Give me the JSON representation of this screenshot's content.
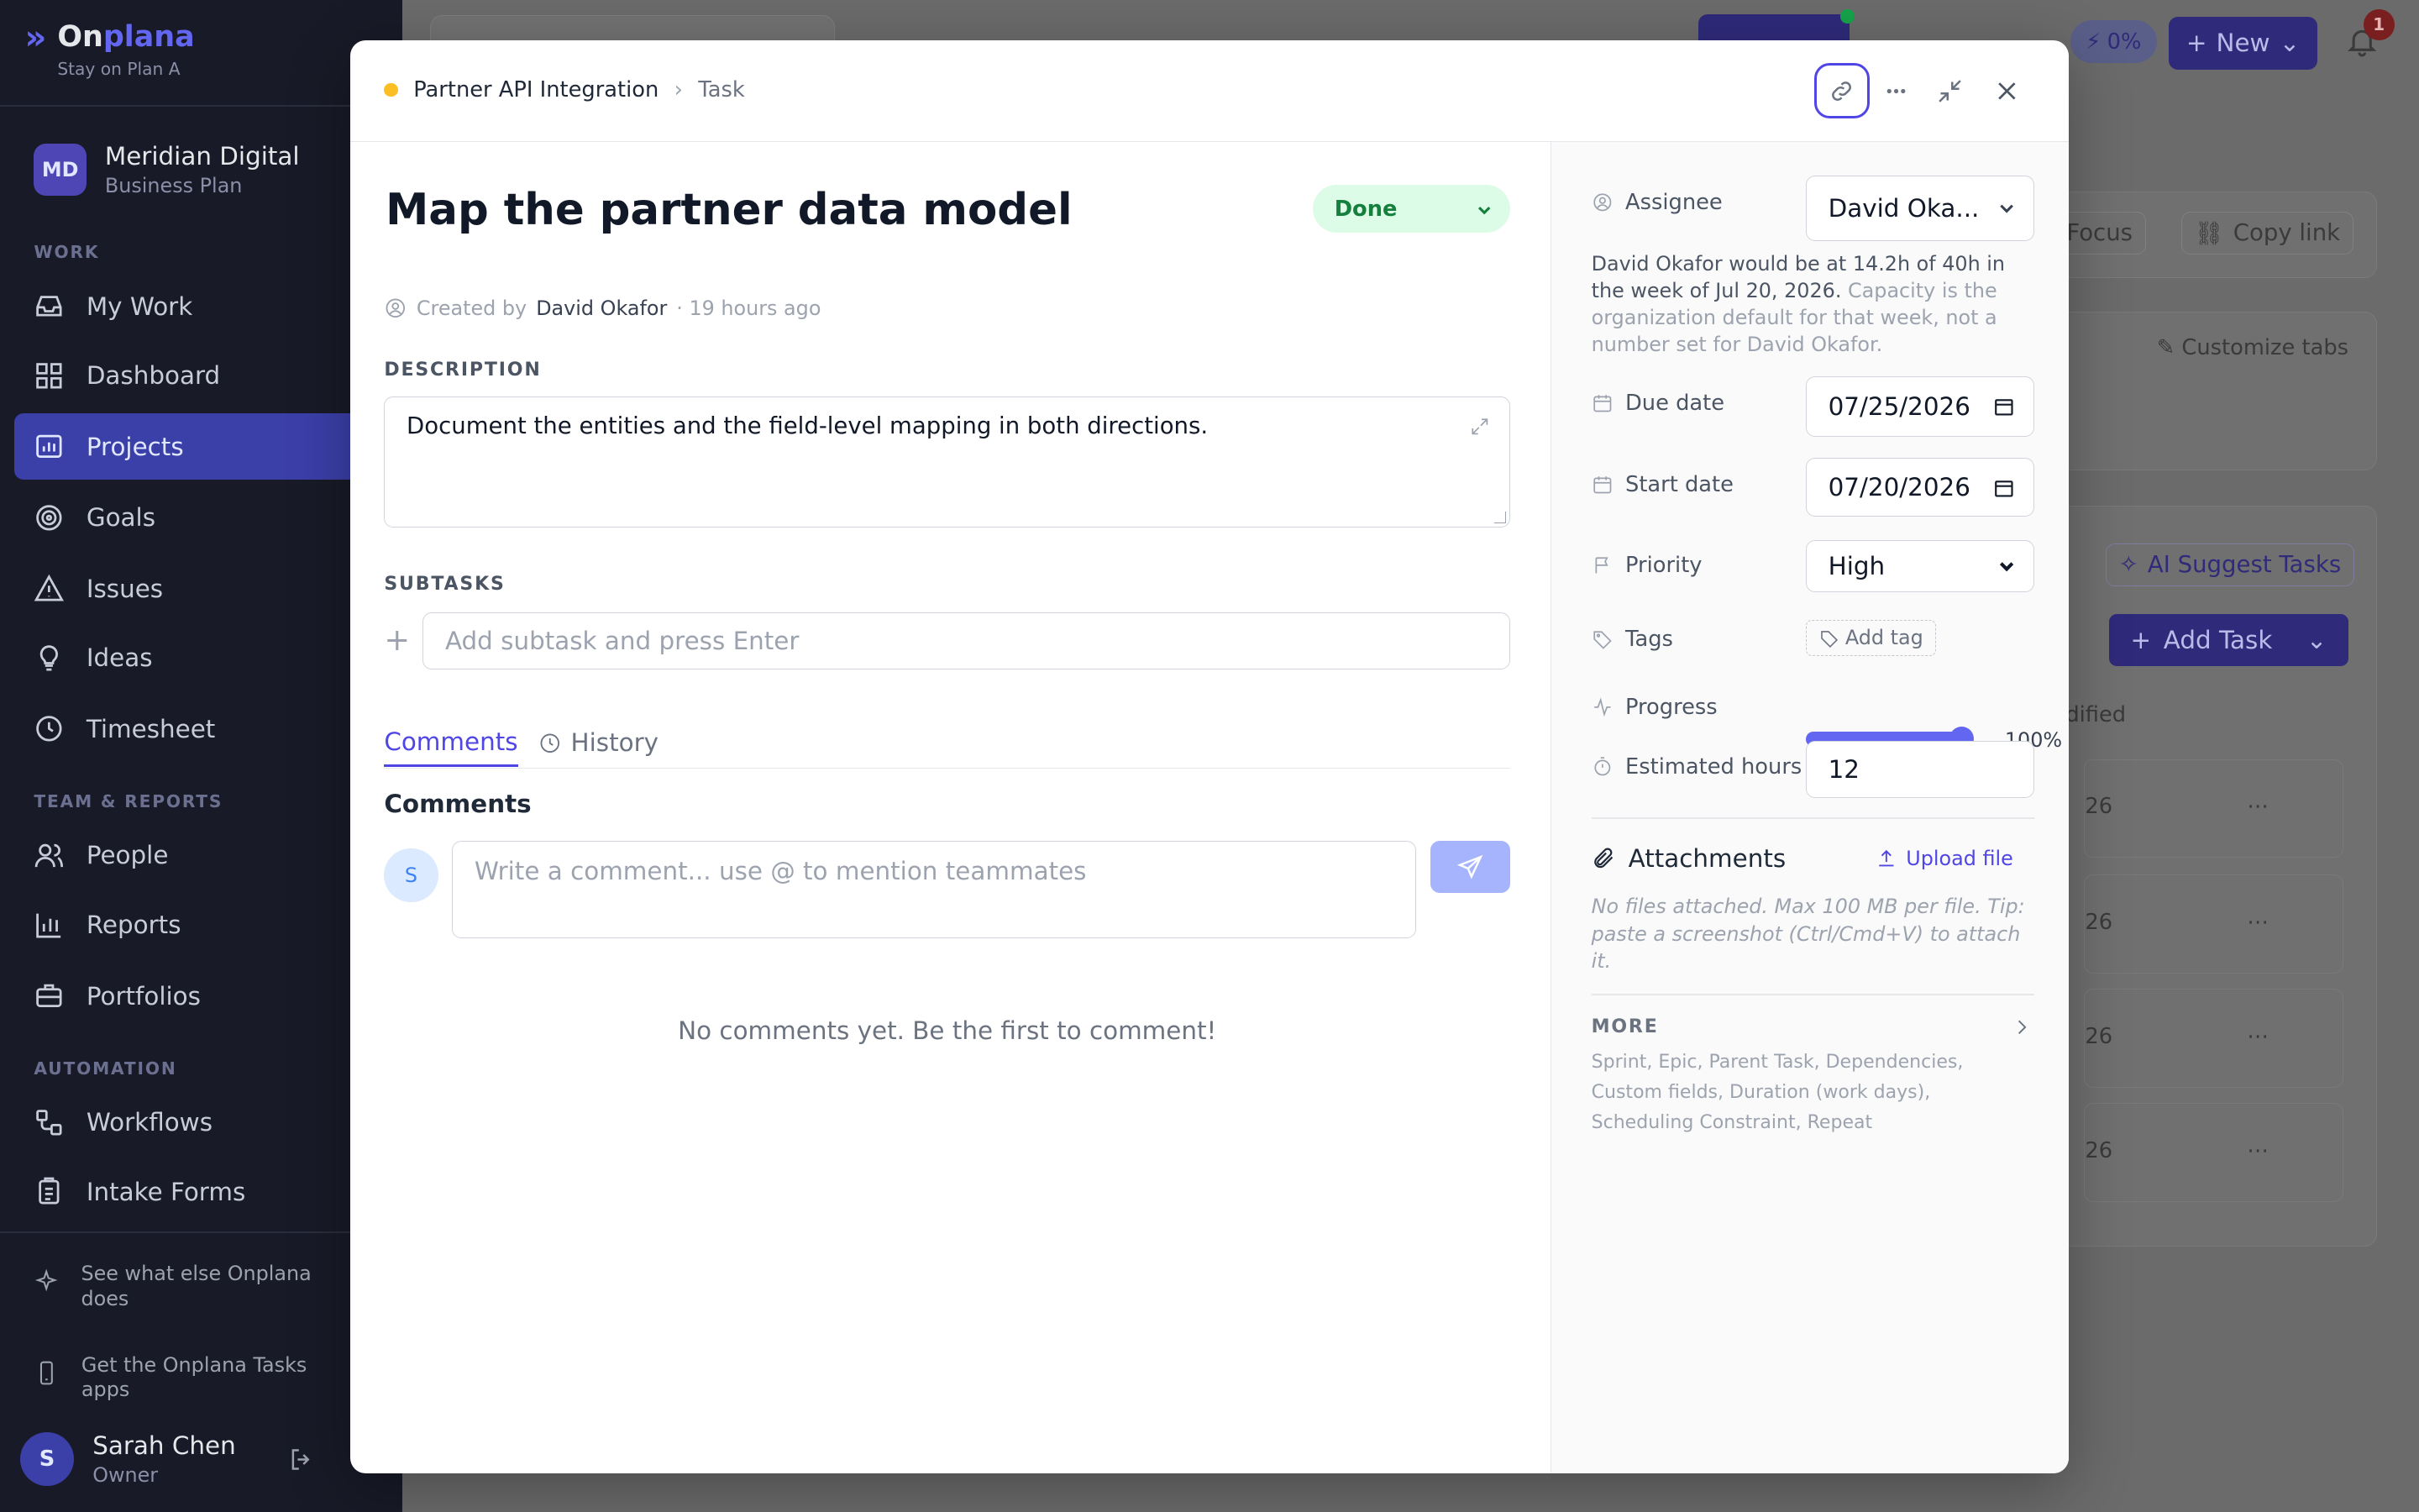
{
  "app": {
    "logo_name_a": "On",
    "logo_name_b": "plana",
    "tagline": "Stay on Plan A"
  },
  "org": {
    "initials": "MD",
    "name": "Meridian Digital",
    "plan": "Business Plan"
  },
  "sidebar": {
    "sections": {
      "work": "WORK",
      "team": "TEAM & REPORTS",
      "automation": "AUTOMATION"
    },
    "items": [
      {
        "label": "My Work",
        "icon": "inbox-icon"
      },
      {
        "label": "Dashboard",
        "icon": "grid-icon"
      },
      {
        "label": "Projects",
        "icon": "folder-chart-icon",
        "active": true
      },
      {
        "label": "Goals",
        "icon": "target-icon"
      },
      {
        "label": "Issues",
        "icon": "warning-icon"
      },
      {
        "label": "Ideas",
        "icon": "lightbulb-icon"
      },
      {
        "label": "Timesheet",
        "icon": "clock-icon"
      },
      {
        "label": "People",
        "icon": "people-icon"
      },
      {
        "label": "Reports",
        "icon": "bar-chart-icon"
      },
      {
        "label": "Portfolios",
        "icon": "briefcase-icon"
      },
      {
        "label": "Workflows",
        "icon": "workflow-icon"
      },
      {
        "label": "Intake Forms",
        "icon": "clipboard-icon"
      }
    ],
    "promo_features": "See what else Onplana does",
    "promo_apps": "Get the Onplana Tasks apps",
    "user": {
      "initial": "S",
      "name": "Sarah Chen",
      "role": "Owner"
    }
  },
  "background": {
    "ai_usage": "0%",
    "new_label": "New",
    "notifications": "1",
    "focus_label": "Focus",
    "copy_link_label": "Copy link",
    "customize_tabs": "Customize tabs",
    "ai_suggest": "AI Suggest Tasks",
    "add_task": "Add Task",
    "column_modified": "dified",
    "row_dates": [
      "26",
      "26",
      "26",
      "26"
    ]
  },
  "modal": {
    "breadcrumb_project": "Partner API Integration",
    "breadcrumb_type": "Task",
    "title": "Map the partner data model",
    "status": "Done",
    "created_by_label": "Created by",
    "created_by": "David Okafor",
    "created_ago": "· 19 hours ago",
    "description_label": "DESCRIPTION",
    "description": "Document the entities and the field-level mapping in both directions.",
    "subtasks_label": "SUBTASKS",
    "subtask_placeholder": "Add subtask and press Enter",
    "tabs": {
      "comments": "Comments",
      "history": "History"
    },
    "comments_heading": "Comments",
    "comment_avatar": "S",
    "comment_placeholder": "Write a comment... use @ to mention teammates",
    "no_comments": "No comments yet. Be the first to comment!"
  },
  "details": {
    "assignee_label": "Assignee",
    "assignee": "David Oka...",
    "capacity_main": "David Okafor would be at 14.2h of 40h in the week of Jul 20, 2026.",
    "capacity_muted": "Capacity is the organization default for that week, not a number set for David Okafor.",
    "due_label": "Due date",
    "due_date": "07/25/2026",
    "start_label": "Start date",
    "start_date": "07/20/2026",
    "priority_label": "Priority",
    "priority": "High",
    "tags_label": "Tags",
    "add_tag": "Add tag",
    "progress_label": "Progress",
    "progress_value": 100,
    "progress_text": "100%",
    "est_label": "Estimated hours",
    "est_hours": "12",
    "attachments_label": "Attachments",
    "upload_label": "Upload file",
    "attachments_note": "No files attached. Max 100 MB per file. Tip: paste a screenshot (Ctrl/Cmd+V) to attach it.",
    "more_label": "MORE",
    "more_list": "Sprint, Epic, Parent Task, Dependencies, Custom fields, Duration (work days), Scheduling Constraint, Repeat"
  }
}
